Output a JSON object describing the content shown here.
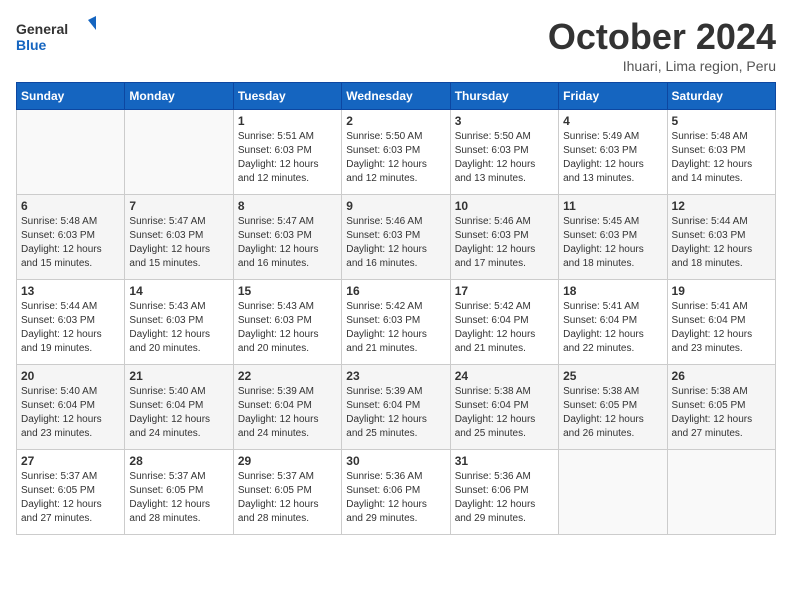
{
  "header": {
    "logo_line1": "General",
    "logo_line2": "Blue",
    "month_title": "October 2024",
    "subtitle": "Ihuari, Lima region, Peru"
  },
  "weekdays": [
    "Sunday",
    "Monday",
    "Tuesday",
    "Wednesday",
    "Thursday",
    "Friday",
    "Saturday"
  ],
  "weeks": [
    [
      {
        "day": "",
        "info": ""
      },
      {
        "day": "",
        "info": ""
      },
      {
        "day": "1",
        "info": "Sunrise: 5:51 AM\nSunset: 6:03 PM\nDaylight: 12 hours and 12 minutes."
      },
      {
        "day": "2",
        "info": "Sunrise: 5:50 AM\nSunset: 6:03 PM\nDaylight: 12 hours and 12 minutes."
      },
      {
        "day": "3",
        "info": "Sunrise: 5:50 AM\nSunset: 6:03 PM\nDaylight: 12 hours and 13 minutes."
      },
      {
        "day": "4",
        "info": "Sunrise: 5:49 AM\nSunset: 6:03 PM\nDaylight: 12 hours and 13 minutes."
      },
      {
        "day": "5",
        "info": "Sunrise: 5:48 AM\nSunset: 6:03 PM\nDaylight: 12 hours and 14 minutes."
      }
    ],
    [
      {
        "day": "6",
        "info": "Sunrise: 5:48 AM\nSunset: 6:03 PM\nDaylight: 12 hours and 15 minutes."
      },
      {
        "day": "7",
        "info": "Sunrise: 5:47 AM\nSunset: 6:03 PM\nDaylight: 12 hours and 15 minutes."
      },
      {
        "day": "8",
        "info": "Sunrise: 5:47 AM\nSunset: 6:03 PM\nDaylight: 12 hours and 16 minutes."
      },
      {
        "day": "9",
        "info": "Sunrise: 5:46 AM\nSunset: 6:03 PM\nDaylight: 12 hours and 16 minutes."
      },
      {
        "day": "10",
        "info": "Sunrise: 5:46 AM\nSunset: 6:03 PM\nDaylight: 12 hours and 17 minutes."
      },
      {
        "day": "11",
        "info": "Sunrise: 5:45 AM\nSunset: 6:03 PM\nDaylight: 12 hours and 18 minutes."
      },
      {
        "day": "12",
        "info": "Sunrise: 5:44 AM\nSunset: 6:03 PM\nDaylight: 12 hours and 18 minutes."
      }
    ],
    [
      {
        "day": "13",
        "info": "Sunrise: 5:44 AM\nSunset: 6:03 PM\nDaylight: 12 hours and 19 minutes."
      },
      {
        "day": "14",
        "info": "Sunrise: 5:43 AM\nSunset: 6:03 PM\nDaylight: 12 hours and 20 minutes."
      },
      {
        "day": "15",
        "info": "Sunrise: 5:43 AM\nSunset: 6:03 PM\nDaylight: 12 hours and 20 minutes."
      },
      {
        "day": "16",
        "info": "Sunrise: 5:42 AM\nSunset: 6:03 PM\nDaylight: 12 hours and 21 minutes."
      },
      {
        "day": "17",
        "info": "Sunrise: 5:42 AM\nSunset: 6:04 PM\nDaylight: 12 hours and 21 minutes."
      },
      {
        "day": "18",
        "info": "Sunrise: 5:41 AM\nSunset: 6:04 PM\nDaylight: 12 hours and 22 minutes."
      },
      {
        "day": "19",
        "info": "Sunrise: 5:41 AM\nSunset: 6:04 PM\nDaylight: 12 hours and 23 minutes."
      }
    ],
    [
      {
        "day": "20",
        "info": "Sunrise: 5:40 AM\nSunset: 6:04 PM\nDaylight: 12 hours and 23 minutes."
      },
      {
        "day": "21",
        "info": "Sunrise: 5:40 AM\nSunset: 6:04 PM\nDaylight: 12 hours and 24 minutes."
      },
      {
        "day": "22",
        "info": "Sunrise: 5:39 AM\nSunset: 6:04 PM\nDaylight: 12 hours and 24 minutes."
      },
      {
        "day": "23",
        "info": "Sunrise: 5:39 AM\nSunset: 6:04 PM\nDaylight: 12 hours and 25 minutes."
      },
      {
        "day": "24",
        "info": "Sunrise: 5:38 AM\nSunset: 6:04 PM\nDaylight: 12 hours and 25 minutes."
      },
      {
        "day": "25",
        "info": "Sunrise: 5:38 AM\nSunset: 6:05 PM\nDaylight: 12 hours and 26 minutes."
      },
      {
        "day": "26",
        "info": "Sunrise: 5:38 AM\nSunset: 6:05 PM\nDaylight: 12 hours and 27 minutes."
      }
    ],
    [
      {
        "day": "27",
        "info": "Sunrise: 5:37 AM\nSunset: 6:05 PM\nDaylight: 12 hours and 27 minutes."
      },
      {
        "day": "28",
        "info": "Sunrise: 5:37 AM\nSunset: 6:05 PM\nDaylight: 12 hours and 28 minutes."
      },
      {
        "day": "29",
        "info": "Sunrise: 5:37 AM\nSunset: 6:05 PM\nDaylight: 12 hours and 28 minutes."
      },
      {
        "day": "30",
        "info": "Sunrise: 5:36 AM\nSunset: 6:06 PM\nDaylight: 12 hours and 29 minutes."
      },
      {
        "day": "31",
        "info": "Sunrise: 5:36 AM\nSunset: 6:06 PM\nDaylight: 12 hours and 29 minutes."
      },
      {
        "day": "",
        "info": ""
      },
      {
        "day": "",
        "info": ""
      }
    ]
  ]
}
